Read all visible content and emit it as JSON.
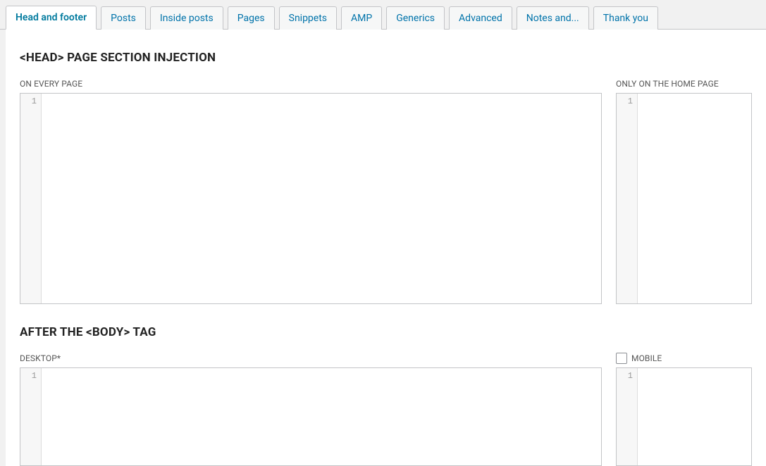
{
  "tabs": [
    {
      "label": "Head and footer",
      "active": true
    },
    {
      "label": "Posts",
      "active": false
    },
    {
      "label": "Inside posts",
      "active": false
    },
    {
      "label": "Pages",
      "active": false
    },
    {
      "label": "Snippets",
      "active": false
    },
    {
      "label": "AMP",
      "active": false
    },
    {
      "label": "Generics",
      "active": false
    },
    {
      "label": "Advanced",
      "active": false
    },
    {
      "label": "Notes and...",
      "active": false
    },
    {
      "label": "Thank you",
      "active": false
    }
  ],
  "section1": {
    "heading": "<HEAD> PAGE SECTION INJECTION",
    "left_label": "ON EVERY PAGE",
    "right_label": "ONLY ON THE HOME PAGE",
    "left_line": "1",
    "right_line": "1"
  },
  "section2": {
    "heading": "AFTER THE <BODY> TAG",
    "left_label": "DESKTOP*",
    "right_label": "MOBILE",
    "left_line": "1",
    "right_line": "1"
  }
}
